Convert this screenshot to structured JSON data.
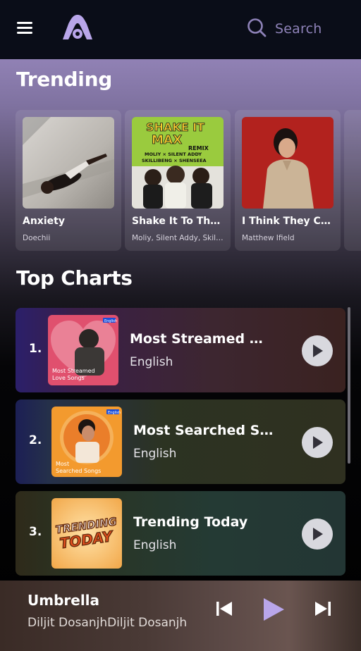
{
  "header": {
    "search_label": "Search"
  },
  "trending": {
    "title": "Trending",
    "items": [
      {
        "title": "Anxiety",
        "artist": "Doechii"
      },
      {
        "title": "Shake It To The Max (Fly) Remix",
        "artist": "Moliy, Silent Addy, Skillibeng, Shenseea",
        "cover_text": [
          "SHAKE IT",
          "MAX",
          "REMIX",
          "MOLIY × SILENT ADDY",
          "SKILLIBENG × SHENSEEA"
        ]
      },
      {
        "title": "I Think They Call This Love",
        "artist": "Matthew Ifield"
      }
    ]
  },
  "top_charts": {
    "title": "Top Charts",
    "items": [
      {
        "rank": "1.",
        "title": "Most Streamed Love Songs",
        "language": "English",
        "cover_text": [
          "Most Streamed",
          "Love Songs"
        ],
        "cover_badge": "English"
      },
      {
        "rank": "2.",
        "title": "Most Searched Songs",
        "language": "English",
        "cover_text": [
          "Most",
          "Searched Songs"
        ],
        "cover_badge": "English"
      },
      {
        "rank": "3.",
        "title": "Trending Today",
        "language": "English",
        "cover_text": [
          "TRENDING",
          "TODAY"
        ]
      }
    ]
  },
  "player": {
    "title": "Umbrella",
    "artist": "Diljit DosanjhDiljit Dosanjh"
  },
  "colors": {
    "accent": "#b9a6ea",
    "topbar": "#0a0d18",
    "search_text": "#8e82b8"
  }
}
